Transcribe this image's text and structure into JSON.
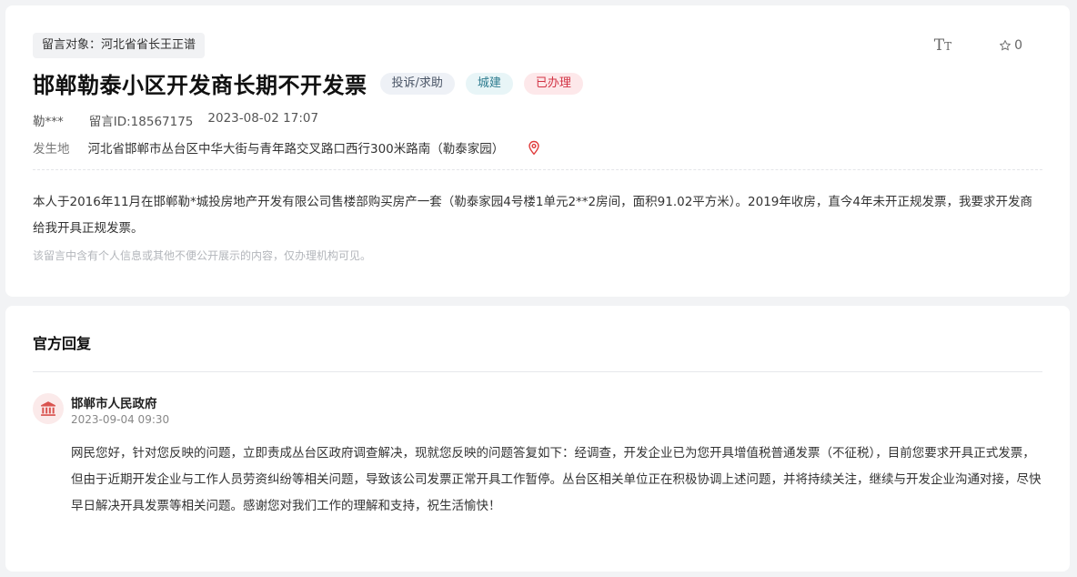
{
  "message": {
    "target_label": "留言对象：河北省省长王正谱",
    "font_toggle": {
      "big": "T",
      "small": "T"
    },
    "favorite": {
      "count": "0",
      "icon": "star-outline-icon"
    },
    "title": "邯郸勒泰小区开发商长期不开发票",
    "tags": {
      "type": "投诉/求助",
      "category": "城建",
      "status": "已办理"
    },
    "author": "勒***",
    "message_id": "留言ID:18567175",
    "datetime": "2023-08-02 17:07",
    "location_label": "发生地",
    "location": "河北省邯郸市丛台区中华大街与青年路交叉路口西行300米路南（勒泰家园）",
    "location_icon": "map-pin-icon",
    "content": "本人于2016年11月在邯郸勒*城投房地产开发有限公司售楼部购买房产一套（勒泰家园4号楼1单元2**2房间，面积91.02平方米）。2019年收房，直今4年未开正规发票，我要求开发商给我开具正规发票。",
    "note": "该留言中含有个人信息或其他不便公开展示的内容，仅办理机构可见。"
  },
  "reply": {
    "section_title": "官方回复",
    "org_name": "邯郸市人民政府",
    "org_icon": "government-building-icon",
    "datetime": "2023-09-04 09:30",
    "content": "网民您好，针对您反映的问题，立即责成丛台区政府调查解决，现就您反映的问题答复如下：经调查，开发企业已为您开具增值税普通发票（不征税），目前您要求开具正式发票，但由于近期开发企业与工作人员劳资纠纷等相关问题，导致该公司发票正常开具工作暂停。丛台区相关单位正在积极协调上述问题，并将持续关注，继续与开发企业沟通对接，尽快早日解决开具发票等相关问题。感谢您对我们工作的理解和支持，祝生活愉快！"
  },
  "colors": {
    "status_red": "#d23344",
    "category_teal": "#2e7c8f",
    "pin_red": "#e03a3a",
    "org_icon_red": "#d9534f"
  }
}
